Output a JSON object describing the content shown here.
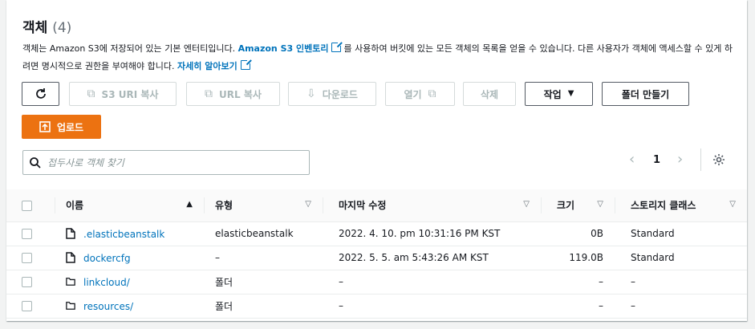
{
  "header": {
    "title": "객체",
    "count": "(4)"
  },
  "description": {
    "text1": "객체는 Amazon S3에 저장되어 있는 기본 엔터티입니다. ",
    "link1": "Amazon S3 인벤토리",
    "text2": "를 사용하여 버킷에 있는 모든 객체의 목록을 얻을 수 있습니다. 다른 사용자가 객체에 액세스할 수 있게 하려면 명시적으로 권한을 부여해야 합니다. ",
    "link2": "자세히 알아보기"
  },
  "toolbar": {
    "refresh_icon": "refresh-icon",
    "copy_s3_uri": "S3 URI 복사",
    "copy_url": "URL 복사",
    "download": "다운로드",
    "open": "열기",
    "delete": "삭제",
    "actions": "작업",
    "create_folder": "폴더 만들기",
    "upload": "업로드"
  },
  "search": {
    "placeholder": "접두사로 객체 찾기"
  },
  "pagination": {
    "current_page": "1"
  },
  "table": {
    "columns": [
      "이름",
      "유형",
      "마지막 수정",
      "크기",
      "스토리지 클래스"
    ],
    "rows": [
      {
        "name": ".elasticbeanstalk",
        "type": "elasticbeanstalk",
        "modified": "2022. 4. 10. pm 10:31:16 PM KST",
        "size": "0B",
        "storage": "Standard",
        "kind": "file"
      },
      {
        "name": "dockercfg",
        "type": "–",
        "modified": "2022. 5. 5. am 5:43:26 AM KST",
        "size": "119.0B",
        "storage": "Standard",
        "kind": "file"
      },
      {
        "name": "linkcloud/",
        "type": "폴더",
        "modified": "–",
        "size": "–",
        "storage": "–",
        "kind": "folder"
      },
      {
        "name": "resources/",
        "type": "폴더",
        "modified": "–",
        "size": "–",
        "storage": "–",
        "kind": "folder"
      }
    ]
  },
  "colors": {
    "link": "#0073bb",
    "primary": "#ec7211",
    "disabled": "#aab7b8"
  }
}
